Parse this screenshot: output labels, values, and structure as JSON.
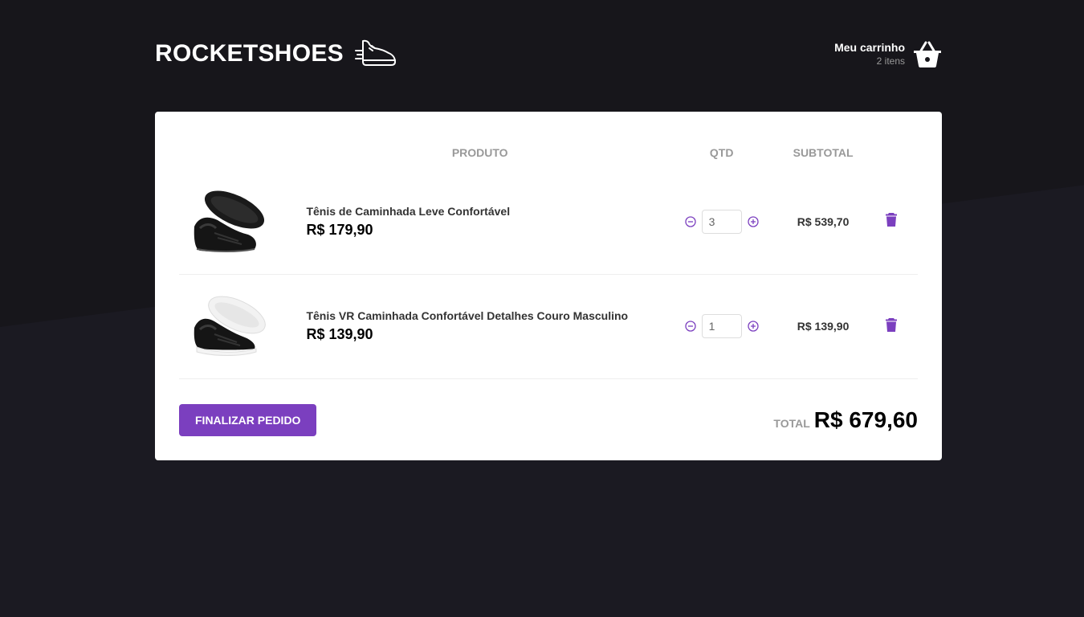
{
  "header": {
    "logo_text": "ROCKETSHOES",
    "cart": {
      "title": "Meu carrinho",
      "count": "2 itens"
    }
  },
  "table": {
    "columns": [
      "",
      "PRODUTO",
      "QTD",
      "SUBTOTAL",
      ""
    ],
    "items": [
      {
        "image": "shoe-black-icon",
        "name": "Tênis de Caminhada Leve Confortável",
        "price": "R$ 179,90",
        "quantity": "3",
        "subtotal": "R$ 539,70"
      },
      {
        "image": "shoe-black-white-sole-icon",
        "name": "Tênis VR Caminhada Confortável Detalhes Couro Masculino",
        "price": "R$ 139,90",
        "quantity": "1",
        "subtotal": "R$ 139,90"
      }
    ]
  },
  "footer": {
    "checkout_label": "Finalizar pedido",
    "total_label": "TOTAL",
    "total_value": "R$ 679,60"
  },
  "colors": {
    "accent": "#7b3fbf",
    "background": "#191920"
  }
}
